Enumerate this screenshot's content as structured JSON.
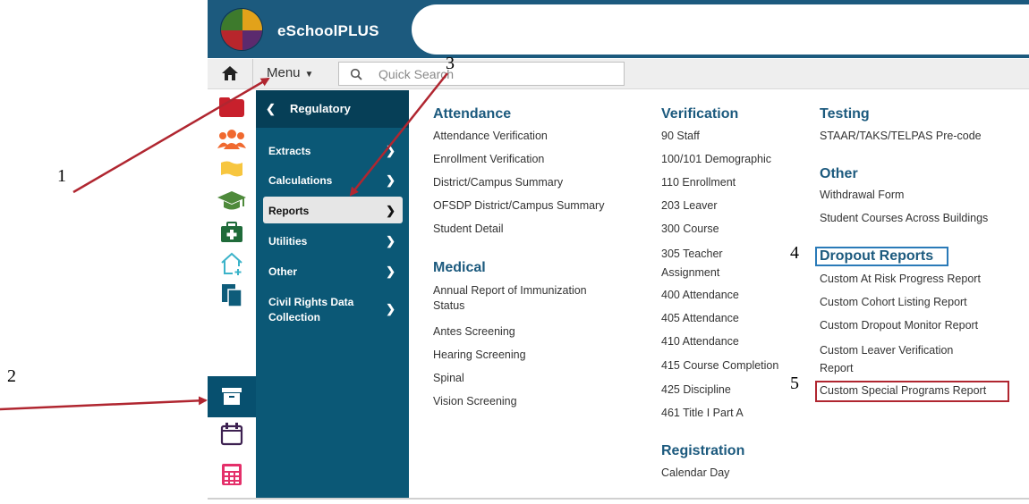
{
  "app": {
    "title": "eSchoolPLUS"
  },
  "toolbar": {
    "menu_label": "Menu",
    "search_placeholder": "Quick Search"
  },
  "regulatory": {
    "title": "Regulatory",
    "items": [
      {
        "label": "Extracts"
      },
      {
        "label": "Calculations"
      },
      {
        "label": "Reports"
      },
      {
        "label": "Utilities"
      },
      {
        "label": "Other"
      },
      {
        "label": "Civil Rights Data Collection"
      }
    ]
  },
  "sections": {
    "attendance": {
      "title": "Attendance",
      "items": [
        "Attendance Verification",
        "Enrollment Verification",
        "District/Campus Summary",
        "OFSDP District/Campus Summary",
        "Student Detail"
      ]
    },
    "medical": {
      "title": "Medical",
      "items": [
        "Annual Report of Immunization Status",
        "Antes Screening",
        "Hearing Screening",
        "Spinal",
        "Vision Screening"
      ]
    },
    "verification": {
      "title": "Verification",
      "items": [
        "90 Staff",
        "100/101 Demographic",
        "110 Enrollment",
        "203 Leaver",
        "300 Course",
        "305 Teacher Assignment",
        "400 Attendance",
        "405 Attendance",
        "410 Attendance",
        "415 Course Completion",
        "425 Discipline",
        "461 Title I Part A"
      ]
    },
    "registration": {
      "title": "Registration",
      "items": [
        "Calendar Day"
      ]
    },
    "testing": {
      "title": "Testing",
      "items": [
        "STAAR/TAKS/TELPAS Pre-code"
      ]
    },
    "other": {
      "title": "Other",
      "items": [
        "Withdrawal Form",
        "Student Courses Across Buildings"
      ]
    },
    "dropout": {
      "title": "Dropout Reports",
      "items": [
        "Custom At Risk Progress Report",
        "Custom Cohort Listing Report",
        "Custom Dropout Monitor Report",
        "Custom Leaver Verification Report",
        "Custom Special Programs Report"
      ]
    }
  },
  "annotations": {
    "n1": "1",
    "n2": "2",
    "n3": "3",
    "n4": "4",
    "n5": "5"
  },
  "icons": [
    "home-icon",
    "caret-down-icon",
    "search-icon",
    "folder-icon",
    "people-icon",
    "flag-icon",
    "graduation-cap-icon",
    "first-aid-kit-icon",
    "house-add-icon",
    "documents-icon",
    "archive-box-icon",
    "calendar-icon",
    "calculator-icon"
  ],
  "colors": {
    "header": "#1c5a7e",
    "panel": "#0b5876",
    "heading": "#1c5a7e",
    "arrow": "#b02630",
    "highlight_blue": "#2a7ab8"
  }
}
